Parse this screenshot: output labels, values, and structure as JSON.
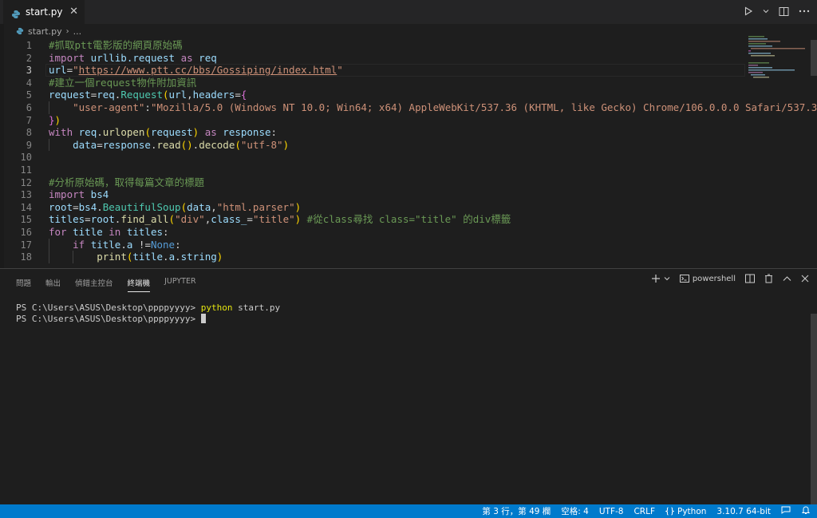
{
  "tab": {
    "file_name": "start.py",
    "close_glyph": "✕"
  },
  "breadcrumb": {
    "file": "start.py",
    "separator": "›",
    "rest": "..."
  },
  "editor": {
    "current_line": 3,
    "lines": [
      {
        "num": "1",
        "segments": [
          {
            "t": "#抓取ptt電影版的網頁原始碼",
            "c": "c-cm"
          }
        ]
      },
      {
        "num": "2",
        "segments": [
          {
            "t": "import",
            "c": "c-kw"
          },
          {
            "t": " urllib.request ",
            "c": "c-var"
          },
          {
            "t": "as",
            "c": "c-kw"
          },
          {
            "t": " req",
            "c": "c-var"
          }
        ]
      },
      {
        "num": "3",
        "segments": [
          {
            "t": "url",
            "c": "c-var"
          },
          {
            "t": "=",
            "c": "c-txt"
          },
          {
            "t": "\"",
            "c": "c-str"
          },
          {
            "t": "https://www.ptt.cc/bbs/Gossiping/index.html",
            "c": "c-str link"
          },
          {
            "t": "\"",
            "c": "c-str"
          }
        ]
      },
      {
        "num": "4",
        "segments": [
          {
            "t": "#建立一個request物件附加資訊",
            "c": "c-cm"
          }
        ]
      },
      {
        "num": "5",
        "segments": [
          {
            "t": "request",
            "c": "c-var"
          },
          {
            "t": "=",
            "c": "c-txt"
          },
          {
            "t": "req",
            "c": "c-var"
          },
          {
            "t": ".",
            "c": "c-txt"
          },
          {
            "t": "Request",
            "c": "c-cls"
          },
          {
            "t": "(",
            "c": "c-br1"
          },
          {
            "t": "url",
            "c": "c-var"
          },
          {
            "t": ",",
            "c": "c-txt"
          },
          {
            "t": "headers",
            "c": "c-var"
          },
          {
            "t": "=",
            "c": "c-txt"
          },
          {
            "t": "{",
            "c": "c-br2"
          }
        ]
      },
      {
        "num": "6",
        "segments": [
          {
            "t": "    ",
            "c": "c-txt"
          },
          {
            "t": "\"user-agent\"",
            "c": "c-str"
          },
          {
            "t": ":",
            "c": "c-txt"
          },
          {
            "t": "\"Mozilla/5.0 (Windows NT 10.0; Win64; x64) AppleWebKit/537.36 (KHTML, like Gecko) Chrome/106.0.0.0 Safari/537.36\"",
            "c": "c-str"
          }
        ]
      },
      {
        "num": "7",
        "segments": [
          {
            "t": "}",
            "c": "c-br2"
          },
          {
            "t": ")",
            "c": "c-br1"
          }
        ]
      },
      {
        "num": "8",
        "segments": [
          {
            "t": "with",
            "c": "c-kw"
          },
          {
            "t": " ",
            "c": "c-txt"
          },
          {
            "t": "req",
            "c": "c-var"
          },
          {
            "t": ".",
            "c": "c-txt"
          },
          {
            "t": "urlopen",
            "c": "c-fn"
          },
          {
            "t": "(",
            "c": "c-br1"
          },
          {
            "t": "request",
            "c": "c-var"
          },
          {
            "t": ")",
            "c": "c-br1"
          },
          {
            "t": " ",
            "c": "c-txt"
          },
          {
            "t": "as",
            "c": "c-kw"
          },
          {
            "t": " response",
            "c": "c-var"
          },
          {
            "t": ":",
            "c": "c-txt"
          }
        ]
      },
      {
        "num": "9",
        "segments": [
          {
            "t": "    ",
            "c": "c-txt"
          },
          {
            "t": "data",
            "c": "c-var"
          },
          {
            "t": "=",
            "c": "c-txt"
          },
          {
            "t": "response",
            "c": "c-var"
          },
          {
            "t": ".",
            "c": "c-txt"
          },
          {
            "t": "read",
            "c": "c-fn"
          },
          {
            "t": "()",
            "c": "c-br1"
          },
          {
            "t": ".",
            "c": "c-txt"
          },
          {
            "t": "decode",
            "c": "c-fn"
          },
          {
            "t": "(",
            "c": "c-br1"
          },
          {
            "t": "\"utf-8\"",
            "c": "c-str"
          },
          {
            "t": ")",
            "c": "c-br1"
          }
        ]
      },
      {
        "num": "10",
        "segments": []
      },
      {
        "num": "11",
        "segments": []
      },
      {
        "num": "12",
        "segments": [
          {
            "t": "#分析原始碼，取得每篇文章的標題",
            "c": "c-cm"
          }
        ]
      },
      {
        "num": "13",
        "segments": [
          {
            "t": "import",
            "c": "c-kw"
          },
          {
            "t": " bs4",
            "c": "c-var"
          }
        ]
      },
      {
        "num": "14",
        "segments": [
          {
            "t": "root",
            "c": "c-var"
          },
          {
            "t": "=",
            "c": "c-txt"
          },
          {
            "t": "bs4",
            "c": "c-var"
          },
          {
            "t": ".",
            "c": "c-txt"
          },
          {
            "t": "BeautifulSoup",
            "c": "c-cls"
          },
          {
            "t": "(",
            "c": "c-br1"
          },
          {
            "t": "data",
            "c": "c-var"
          },
          {
            "t": ",",
            "c": "c-txt"
          },
          {
            "t": "\"html.parser\"",
            "c": "c-str"
          },
          {
            "t": ")",
            "c": "c-br1"
          }
        ]
      },
      {
        "num": "15",
        "segments": [
          {
            "t": "titles",
            "c": "c-var"
          },
          {
            "t": "=",
            "c": "c-txt"
          },
          {
            "t": "root",
            "c": "c-var"
          },
          {
            "t": ".",
            "c": "c-txt"
          },
          {
            "t": "find_all",
            "c": "c-fn"
          },
          {
            "t": "(",
            "c": "c-br1"
          },
          {
            "t": "\"div\"",
            "c": "c-str"
          },
          {
            "t": ",",
            "c": "c-txt"
          },
          {
            "t": "class_",
            "c": "c-var"
          },
          {
            "t": "=",
            "c": "c-txt"
          },
          {
            "t": "\"title\"",
            "c": "c-str"
          },
          {
            "t": ")",
            "c": "c-br1"
          },
          {
            "t": " #從class尋找 class=\"title\" 的div標籤",
            "c": "c-cm"
          }
        ]
      },
      {
        "num": "16",
        "segments": [
          {
            "t": "for",
            "c": "c-kw"
          },
          {
            "t": " title ",
            "c": "c-var"
          },
          {
            "t": "in",
            "c": "c-kw"
          },
          {
            "t": " titles",
            "c": "c-var"
          },
          {
            "t": ":",
            "c": "c-txt"
          }
        ]
      },
      {
        "num": "17",
        "segments": [
          {
            "t": "    ",
            "c": "c-txt"
          },
          {
            "t": "if",
            "c": "c-kw"
          },
          {
            "t": " title",
            "c": "c-var"
          },
          {
            "t": ".",
            "c": "c-txt"
          },
          {
            "t": "a",
            "c": "c-var"
          },
          {
            "t": " !=",
            "c": "c-txt"
          },
          {
            "t": "None",
            "c": "c-blue"
          },
          {
            "t": ":",
            "c": "c-txt"
          }
        ]
      },
      {
        "num": "18",
        "segments": [
          {
            "t": "        ",
            "c": "c-txt"
          },
          {
            "t": "print",
            "c": "c-fn"
          },
          {
            "t": "(",
            "c": "c-br1"
          },
          {
            "t": "title",
            "c": "c-var"
          },
          {
            "t": ".",
            "c": "c-txt"
          },
          {
            "t": "a",
            "c": "c-var"
          },
          {
            "t": ".",
            "c": "c-txt"
          },
          {
            "t": "string",
            "c": "c-var"
          },
          {
            "t": ")",
            "c": "c-br1"
          }
        ]
      }
    ]
  },
  "panel": {
    "tabs": [
      "問題",
      "輸出",
      "偵錯主控台",
      "終端機",
      "JUPYTER"
    ],
    "active_tab": 3,
    "shell_label": "powershell",
    "terminal_lines": [
      {
        "prompt": "PS C:\\Users\\ASUS\\Desktop\\ppppyyyy> ",
        "command": "python",
        "args": " start.py"
      },
      {
        "prompt": "PS C:\\Users\\ASUS\\Desktop\\ppppyyyy> ",
        "command": "",
        "args": ""
      }
    ]
  },
  "statusbar": {
    "position": "第 3 行，第 49 欄",
    "spaces": "空格: 4",
    "encoding": "UTF-8",
    "eol": "CRLF",
    "language": "Python",
    "interpreter": "3.10.7 64-bit"
  },
  "colors": {
    "accent": "#007acc",
    "background": "#1e1e1e",
    "comment": "#6a9955",
    "keyword": "#c586c0",
    "string": "#ce9178",
    "variable": "#9cdcfe",
    "function": "#dcdcaa"
  }
}
